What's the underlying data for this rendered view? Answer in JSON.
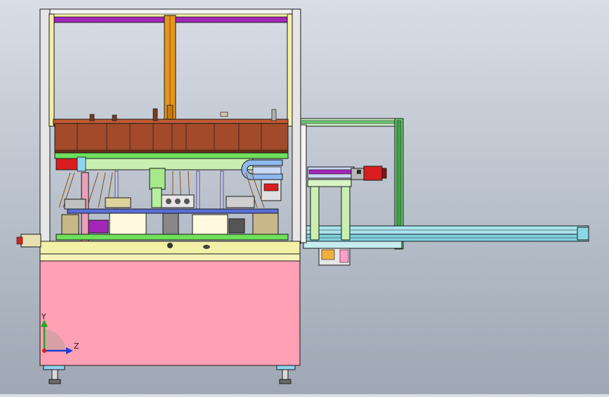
{
  "viewport": {
    "background_top": "#d9dde6",
    "background_bottom": "#9ea7b3"
  },
  "triad": {
    "y_label": "Y",
    "z_label": "Z",
    "y_color": "#1fa81f",
    "z_color": "#1a3fd6",
    "x_color": "#d62020"
  },
  "colors": {
    "frame_yellow": "#f3f0a8",
    "frame_gray": "#d9d9d9",
    "cabinet_pink": "#ffa0b4",
    "rail_cyan": "#7fd3e0",
    "rail_green": "#3fa24a",
    "copper": "#a24a2a",
    "magenta": "#a326b8",
    "orange_pole": "#e6961e",
    "plate_lime": "#6fe05a",
    "plate_light_green": "#c9f0b0",
    "motor_red": "#d81e1e"
  },
  "parts": [
    "machine-frame-icon",
    "tray-copper-icon",
    "cabinet-base-icon",
    "linear-rail-icon",
    "servo-motor-icon",
    "cable-chain-icon",
    "leveling-foot-icon"
  ]
}
